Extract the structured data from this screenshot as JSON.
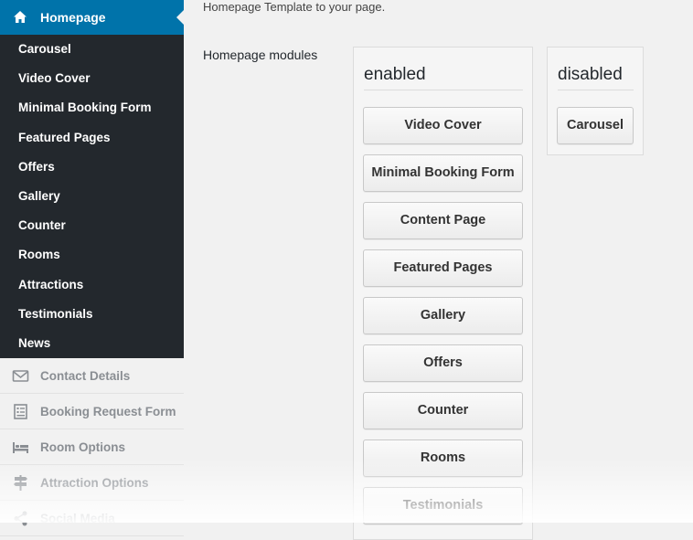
{
  "sidebar": {
    "active": {
      "label": "Homepage",
      "icon": "home-icon"
    },
    "submenu": [
      {
        "label": "Carousel"
      },
      {
        "label": "Video Cover"
      },
      {
        "label": "Minimal Booking Form"
      },
      {
        "label": "Featured Pages"
      },
      {
        "label": "Offers"
      },
      {
        "label": "Gallery"
      },
      {
        "label": "Counter"
      },
      {
        "label": "Rooms"
      },
      {
        "label": "Attractions"
      },
      {
        "label": "Testimonials"
      },
      {
        "label": "News"
      }
    ],
    "lower": [
      {
        "label": "Contact Details",
        "icon": "envelope-icon"
      },
      {
        "label": "Booking Request Form",
        "icon": "form-icon"
      },
      {
        "label": "Room Options",
        "icon": "bed-icon"
      },
      {
        "label": "Attraction Options",
        "icon": "signpost-icon"
      },
      {
        "label": "Social Media",
        "icon": "share-icon"
      }
    ]
  },
  "main": {
    "intro_text": "Homepage Template to your page.",
    "modules_label": "Homepage modules",
    "enabled": {
      "title": "enabled",
      "modules": [
        "Video Cover",
        "Minimal Booking Form",
        "Content Page",
        "Featured Pages",
        "Gallery",
        "Offers",
        "Counter",
        "Rooms",
        "Testimonials"
      ]
    },
    "disabled": {
      "title": "disabled",
      "modules": [
        "Carousel"
      ]
    }
  },
  "colors": {
    "sidebar_bg": "#23282d",
    "active_bg": "#0073aa",
    "page_bg": "#f1f1f1"
  }
}
